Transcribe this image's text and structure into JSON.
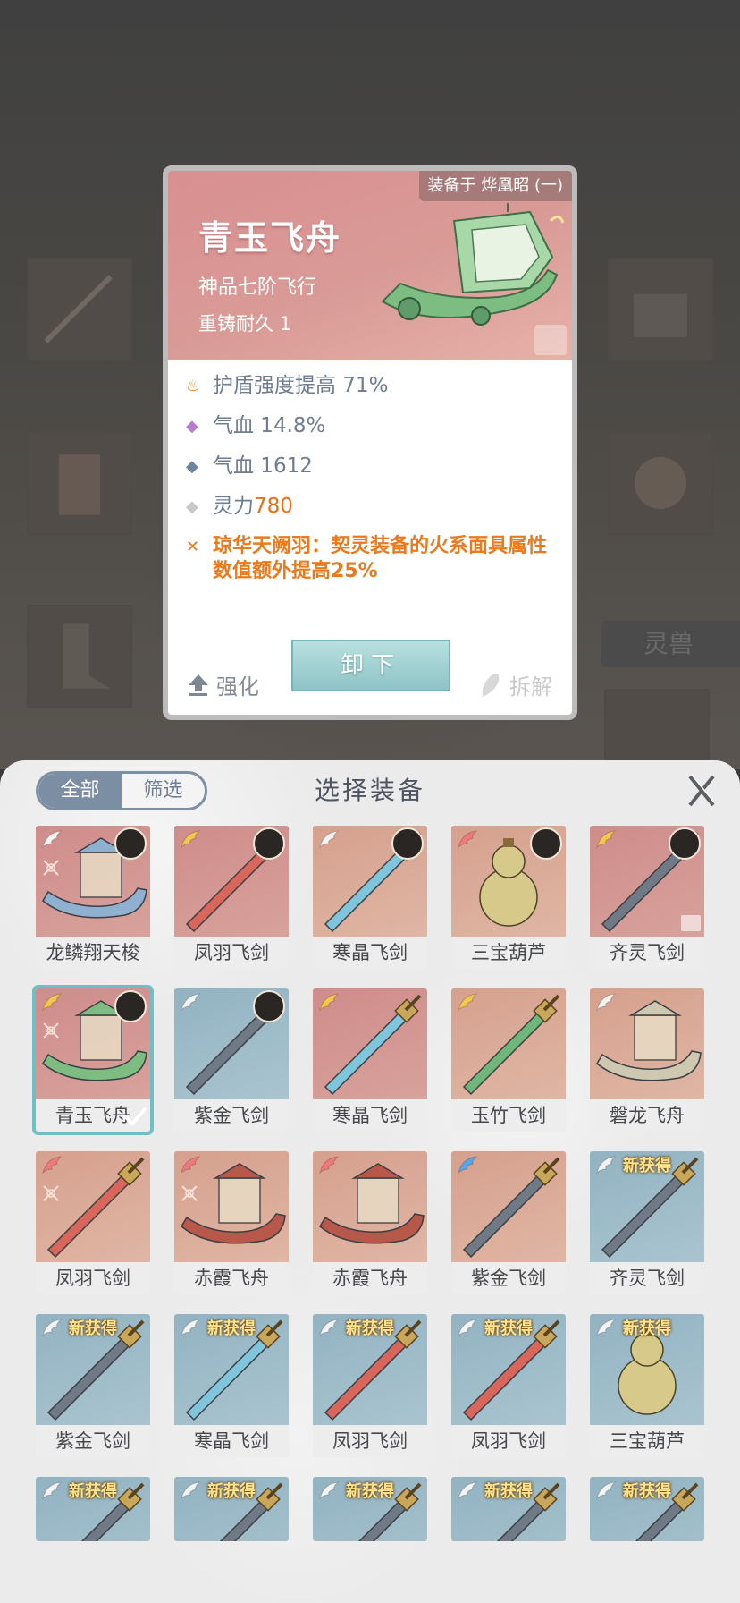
{
  "background": {
    "side_tag": "灵兽"
  },
  "card": {
    "owner_label": "装备于 烨凰昭 (一)",
    "title": "青玉飞舟",
    "grade": "神品七阶飞行",
    "recast": "重铸耐久 1",
    "stats": [
      {
        "marker": "fire-orange",
        "label": "护盾强度提高 71%",
        "value": ""
      },
      {
        "marker": "diamond-purple",
        "label": "气血 14.8%",
        "value": ""
      },
      {
        "marker": "diamond-blue",
        "label": "气血 1612",
        "value": ""
      },
      {
        "marker": "diamond-gray",
        "label": "灵力 ",
        "value": "780"
      }
    ],
    "special": "琼华天阙羽：契灵装备的火系面具属性数值额外提高25%",
    "btn_strengthen": "强化",
    "btn_unload": "卸下",
    "btn_dismantle": "拆解"
  },
  "sheet": {
    "tab_all": "全部",
    "tab_filter": "筛选",
    "title": "选择装备",
    "new_badge": "新获得",
    "items": [
      {
        "name": "龙鳞翔天梭",
        "bg": "red",
        "wing": "white",
        "avatar": true
      },
      {
        "name": "凤羽飞剑",
        "bg": "red",
        "wing": "rainbow",
        "avatar": true
      },
      {
        "name": "寒晶飞剑",
        "bg": "peach",
        "wing": "white",
        "avatar": true
      },
      {
        "name": "三宝葫芦",
        "bg": "peach",
        "wing": "red",
        "avatar": true
      },
      {
        "name": "齐灵飞剑",
        "bg": "red",
        "wing": "rainbow",
        "avatar": true
      },
      {
        "name": "青玉飞舟",
        "bg": "red",
        "wing": "rainbow",
        "avatar": true,
        "selected": true
      },
      {
        "name": "紫金飞剑",
        "bg": "blue",
        "wing": "white",
        "avatar": true
      },
      {
        "name": "寒晶飞剑",
        "bg": "red",
        "wing": "rainbow",
        "avatar": false
      },
      {
        "name": "玉竹飞剑",
        "bg": "peach",
        "wing": "rainbow",
        "avatar": false
      },
      {
        "name": "磐龙飞舟",
        "bg": "peach",
        "wing": "white",
        "avatar": false
      },
      {
        "name": "凤羽飞剑",
        "bg": "peach",
        "wing": "red",
        "avatar": false
      },
      {
        "name": "赤霞飞舟",
        "bg": "peach",
        "wing": "red",
        "avatar": false
      },
      {
        "name": "赤霞飞舟",
        "bg": "peach",
        "wing": "red",
        "avatar": false
      },
      {
        "name": "紫金飞剑",
        "bg": "peach",
        "wing": "blue",
        "avatar": false
      },
      {
        "name": "齐灵飞剑",
        "bg": "blue",
        "wing": "white",
        "avatar": false,
        "new": true
      },
      {
        "name": "紫金飞剑",
        "bg": "blue",
        "wing": "white",
        "avatar": false,
        "new": true
      },
      {
        "name": "寒晶飞剑",
        "bg": "blue",
        "wing": "white",
        "avatar": false,
        "new": true
      },
      {
        "name": "凤羽飞剑",
        "bg": "blue",
        "wing": "white",
        "avatar": false,
        "new": true
      },
      {
        "name": "凤羽飞剑",
        "bg": "blue",
        "wing": "white",
        "avatar": false,
        "new": true
      },
      {
        "name": "三宝葫芦",
        "bg": "blue",
        "wing": "white",
        "avatar": false,
        "new": true
      },
      {
        "name": "",
        "bg": "blue",
        "wing": "white",
        "avatar": false,
        "new": true
      },
      {
        "name": "",
        "bg": "blue",
        "wing": "white",
        "avatar": false,
        "new": true
      },
      {
        "name": "",
        "bg": "blue",
        "wing": "white",
        "avatar": false,
        "new": true
      },
      {
        "name": "",
        "bg": "blue",
        "wing": "white",
        "avatar": false,
        "new": true
      },
      {
        "name": "",
        "bg": "blue",
        "wing": "white",
        "avatar": false,
        "new": true
      }
    ]
  }
}
